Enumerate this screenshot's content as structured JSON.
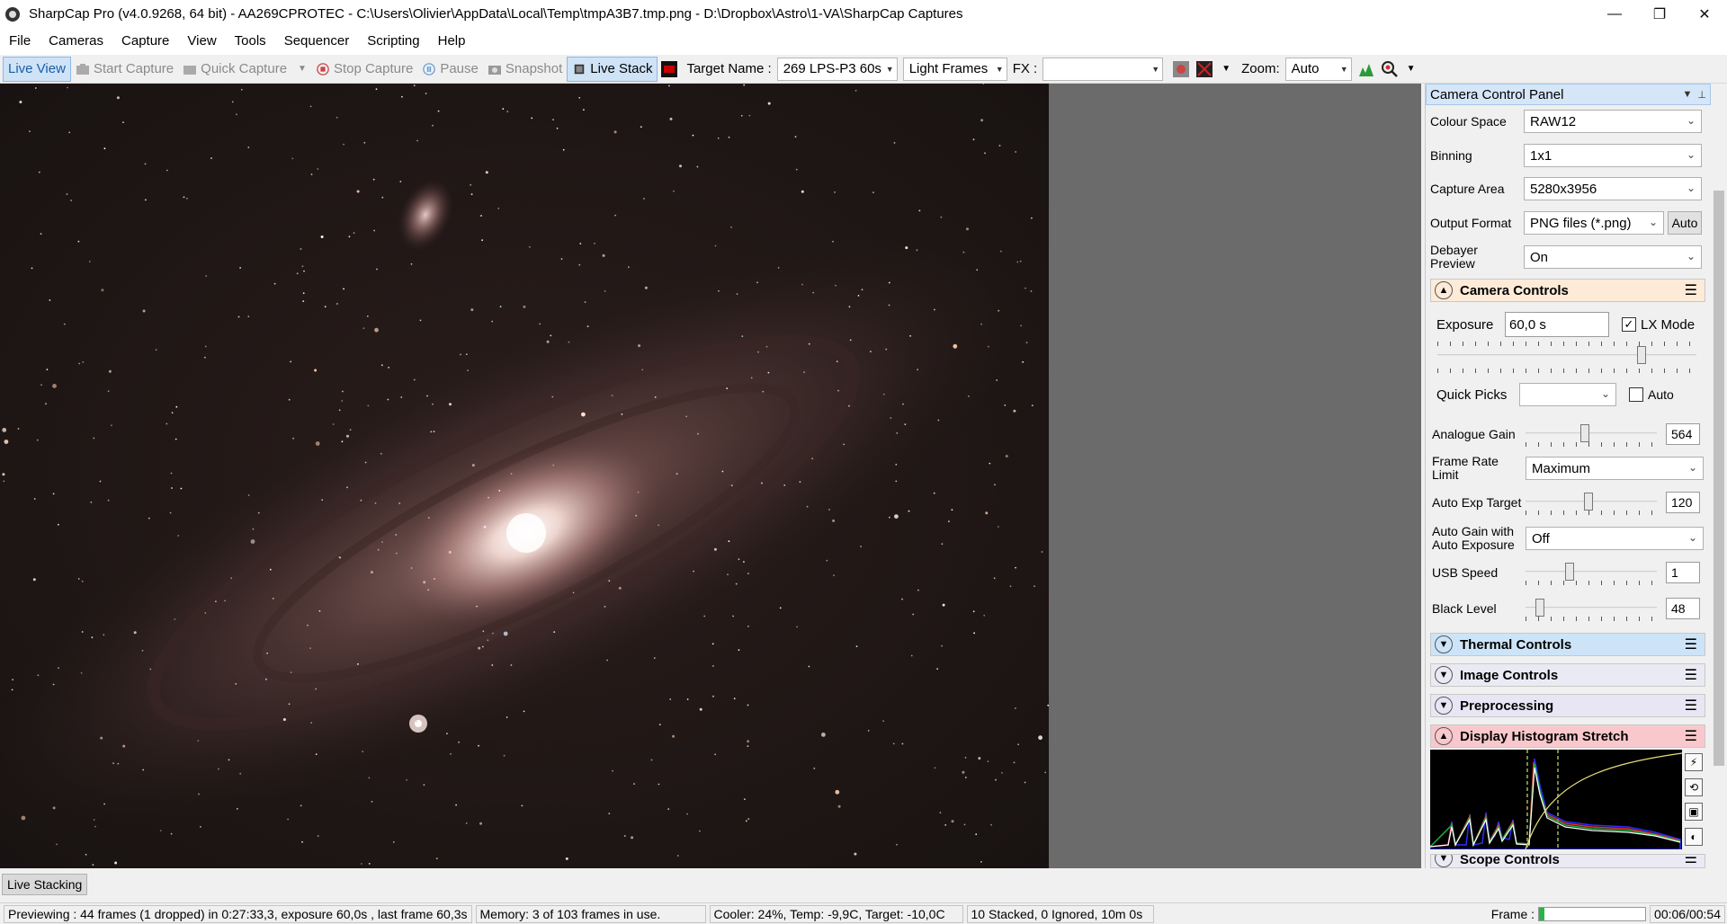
{
  "titlebar": {
    "title": "SharpCap Pro (v4.0.9268, 64 bit) - AA269CPROTEC - C:\\Users\\Olivier\\AppData\\Local\\Temp\\tmpA3B7.tmp.png - D:\\Dropbox\\Astro\\1-VA\\SharpCap Captures",
    "minimize": "—",
    "maximize": "❐",
    "close": "✕"
  },
  "menu": [
    "File",
    "Cameras",
    "Capture",
    "View",
    "Tools",
    "Sequencer",
    "Scripting",
    "Help"
  ],
  "toolbar": {
    "live_view": "Live View",
    "start_capture": "Start Capture",
    "quick_capture": "Quick Capture",
    "stop_capture": "Stop Capture",
    "pause": "Pause",
    "snapshot": "Snapshot",
    "live_stack": "Live Stack",
    "target_name_label": "Target Name :",
    "target_name_value": "269 LPS-P3 60s",
    "frame_type_value": "Light Frames",
    "fx_label": "FX :",
    "fx_value": "",
    "zoom_label": "Zoom:",
    "zoom_value": "Auto"
  },
  "panel": {
    "title": "Camera Control Panel",
    "colour_space_label": "Colour Space",
    "colour_space_value": "RAW12",
    "binning_label": "Binning",
    "binning_value": "1x1",
    "capture_area_label": "Capture Area",
    "capture_area_value": "5280x3956",
    "output_format_label": "Output Format",
    "output_format_value": "PNG files (*.png)",
    "output_format_auto": "Auto",
    "debayer_label": "Debayer Preview",
    "debayer_value": "On"
  },
  "camera_controls": {
    "title": "Camera Controls",
    "exposure_label": "Exposure",
    "exposure_value": "60,0 s",
    "lx_mode_label": "LX Mode",
    "lx_mode_checked": true,
    "exposure_slider": 0.8,
    "quick_picks_label": "Quick Picks",
    "quick_picks_value": "",
    "auto_label": "Auto",
    "auto_checked": false,
    "analogue_gain_label": "Analogue Gain",
    "analogue_gain_value": "564",
    "analogue_gain_slider": 0.45,
    "frame_rate_label": "Frame Rate Limit",
    "frame_rate_value": "Maximum",
    "auto_exp_target_label": "Auto Exp Target",
    "auto_exp_target_value": "120",
    "auto_exp_target_slider": 0.48,
    "auto_gain_label": "Auto Gain with Auto Exposure",
    "auto_gain_value": "Off",
    "usb_speed_label": "USB Speed",
    "usb_speed_value": "1",
    "usb_speed_slider": 0.32,
    "black_level_label": "Black Level",
    "black_level_value": "48",
    "black_level_slider": 0.08
  },
  "sections": {
    "thermal": "Thermal Controls",
    "image": "Image Controls",
    "preprocessing": "Preprocessing",
    "histogram": "Display Histogram Stretch",
    "scope": "Scope Controls"
  },
  "colors": {
    "thermal_bg": "#cde4f8",
    "image_bg": "#eaeaf5",
    "preprocessing_bg": "#e8e6f4",
    "histogram_bg": "#f9c8cc",
    "camera_controls_bg": "#fdebd8"
  },
  "bottom_tab": "Live Stacking",
  "status": {
    "preview": "Previewing : 44 frames (1 dropped) in 0:27:33,3, exposure 60,0s , last frame 60,3s",
    "memory": "Memory: 3 of 103 frames in use.",
    "cooler": "Cooler: 24%, Temp: -9,9C, Target: -10,0C",
    "stacked": "10 Stacked, 0 Ignored, 10m 0s",
    "frame_label": "Frame :",
    "frame_progress": 0.05,
    "frame_time": "00:06/00:54"
  }
}
